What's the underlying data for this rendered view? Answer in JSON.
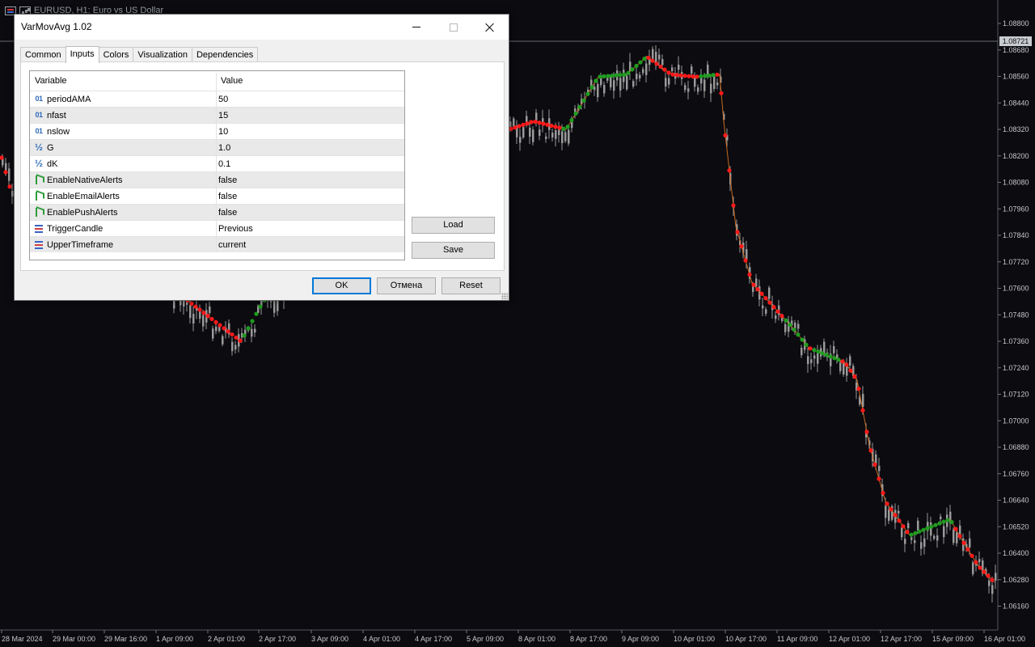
{
  "chart": {
    "title": "EURUSD, H1:  Euro vs US Dollar",
    "current_price": "1.08721",
    "colors": {
      "background": "#0b0b10",
      "candle": "#9a9a9a",
      "dot_down": "#ff1a1a",
      "dot_up": "#1f9c1f",
      "line": "#c8691e",
      "axis_text": "#c8c8c8",
      "grid": "#3a3a44"
    },
    "price_labels": [
      "1.08800",
      "1.08680",
      "1.08560",
      "1.08440",
      "1.08320",
      "1.08200",
      "1.08080",
      "1.07960",
      "1.07840",
      "1.07720",
      "1.07600",
      "1.07480",
      "1.07360",
      "1.07240",
      "1.07120",
      "1.07000",
      "1.06880",
      "1.06760",
      "1.06640",
      "1.06520",
      "1.06400",
      "1.06280",
      "1.06160"
    ],
    "time_labels": [
      "28 Mar 2024",
      "29 Mar 00:00",
      "29 Mar 16:00",
      "1 Apr 09:00",
      "2 Apr 01:00",
      "2 Apr 17:00",
      "3 Apr 09:00",
      "4 Apr 01:00",
      "4 Apr 17:00",
      "5 Apr 09:00",
      "8 Apr 01:00",
      "8 Apr 17:00",
      "9 Apr 09:00",
      "10 Apr 01:00",
      "10 Apr 17:00",
      "11 Apr 09:00",
      "12 Apr 01:00",
      "12 Apr 17:00",
      "15 Apr 09:00",
      "16 Apr 01:00"
    ]
  },
  "dialog": {
    "title": "VarMovAvg 1.02",
    "tabs": [
      "Common",
      "Inputs",
      "Colors",
      "Visualization",
      "Dependencies"
    ],
    "active_tab": "Inputs",
    "grid": {
      "col_variable": "Variable",
      "col_value": "Value",
      "rows": [
        {
          "icon": "01",
          "type": "int",
          "name": "periodAMA",
          "value": "50"
        },
        {
          "icon": "01",
          "type": "int",
          "name": "nfast",
          "value": "15"
        },
        {
          "icon": "01",
          "type": "int",
          "name": "nslow",
          "value": "10"
        },
        {
          "icon": "½",
          "type": "double",
          "name": "G",
          "value": "1.0"
        },
        {
          "icon": "½",
          "type": "double",
          "name": "dK",
          "value": "0.1"
        },
        {
          "icon": "",
          "type": "bool",
          "name": "EnableNativeAlerts",
          "value": "false"
        },
        {
          "icon": "",
          "type": "bool",
          "name": "EnableEmailAlerts",
          "value": "false"
        },
        {
          "icon": "",
          "type": "bool",
          "name": "EnablePushAlerts",
          "value": "false"
        },
        {
          "icon": "",
          "type": "enum",
          "name": "TriggerCandle",
          "value": "Previous"
        },
        {
          "icon": "",
          "type": "enum",
          "name": "UpperTimeframe",
          "value": "current"
        }
      ]
    },
    "buttons": {
      "load": "Load",
      "save": "Save",
      "ok": "OK",
      "cancel": "Отмена",
      "reset": "Reset"
    }
  }
}
